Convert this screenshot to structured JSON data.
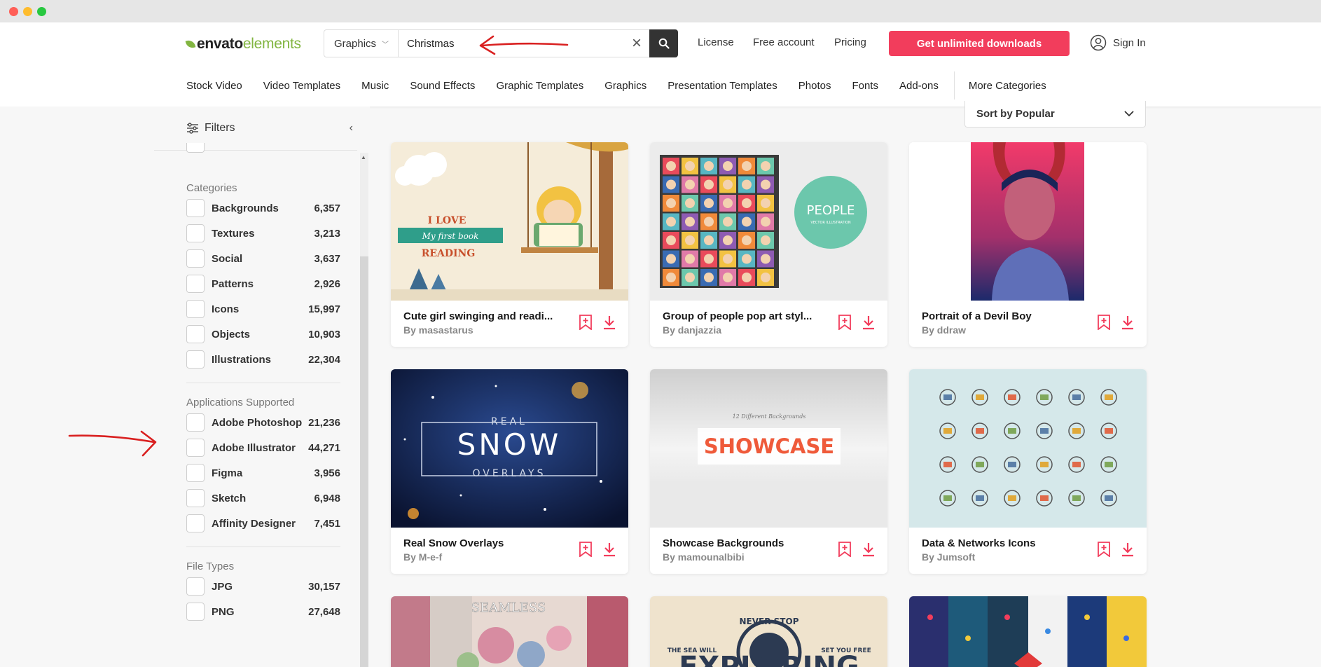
{
  "window": {
    "traffic_lights": [
      "#ff5f57",
      "#febc2e",
      "#28c840"
    ]
  },
  "header": {
    "logo": {
      "part1": "envato",
      "part2": "elements"
    },
    "search": {
      "category": "Graphics",
      "query": "Christmas"
    },
    "links": [
      "License",
      "Free account",
      "Pricing"
    ],
    "cta": "Get unlimited downloads",
    "signin": "Sign In"
  },
  "nav": {
    "items": [
      "Stock Video",
      "Video Templates",
      "Music",
      "Sound Effects",
      "Graphic Templates",
      "Graphics",
      "Presentation Templates",
      "Photos",
      "Fonts",
      "Add-ons"
    ],
    "more": "More Categories"
  },
  "sidebar": {
    "filters_label": "Filters",
    "categories": {
      "title": "Categories",
      "items": [
        {
          "label": "Backgrounds",
          "count": "6,357"
        },
        {
          "label": "Textures",
          "count": "3,213"
        },
        {
          "label": "Social",
          "count": "3,637"
        },
        {
          "label": "Patterns",
          "count": "2,926"
        },
        {
          "label": "Icons",
          "count": "15,997"
        },
        {
          "label": "Objects",
          "count": "10,903"
        },
        {
          "label": "Illustrations",
          "count": "22,304"
        }
      ]
    },
    "applications": {
      "title": "Applications Supported",
      "items": [
        {
          "label": "Adobe Photoshop",
          "count": "21,236"
        },
        {
          "label": "Adobe Illustrator",
          "count": "44,271"
        },
        {
          "label": "Figma",
          "count": "3,956"
        },
        {
          "label": "Sketch",
          "count": "6,948"
        },
        {
          "label": "Affinity Designer",
          "count": "7,451"
        }
      ]
    },
    "file_types": {
      "title": "File Types",
      "items": [
        {
          "label": "JPG",
          "count": "30,157"
        },
        {
          "label": "PNG",
          "count": "27,648"
        }
      ]
    }
  },
  "sort": {
    "label": "Sort by Popular"
  },
  "cards": [
    {
      "title": "Cute girl swinging and readi...",
      "author": "By masastarus",
      "thumb_text": [
        "I LOVE",
        "My first book",
        "READING"
      ]
    },
    {
      "title": "Group of people pop art styl...",
      "author": "By danjazzia",
      "thumb_text": [
        "PEOPLE",
        "VECTOR ILLUSTRATION"
      ]
    },
    {
      "title": "Portrait of a Devil Boy",
      "author": "By ddraw"
    },
    {
      "title": "Real Snow Overlays",
      "author": "By M-e-f",
      "thumb_text": [
        "REAL",
        "SNOW",
        "OVERLAYS"
      ]
    },
    {
      "title": "Showcase Backgrounds",
      "author": "By mamounalbibi",
      "thumb_text": [
        "12 Different Backgrounds",
        "SHOWCASE"
      ]
    },
    {
      "title": "Data & Networks Icons",
      "author": "By Jumsoft"
    }
  ],
  "partial_cards": [
    {
      "thumb_text": "SEAMLESS"
    },
    {
      "thumb_text": [
        "NEVER STOP",
        "THE SEA WILL",
        "SET YOU FREE",
        "EXPLORING"
      ]
    },
    {}
  ],
  "colors": {
    "accent": "#f23d5c",
    "brand_green": "#82b541",
    "annotation": "#d92020"
  }
}
